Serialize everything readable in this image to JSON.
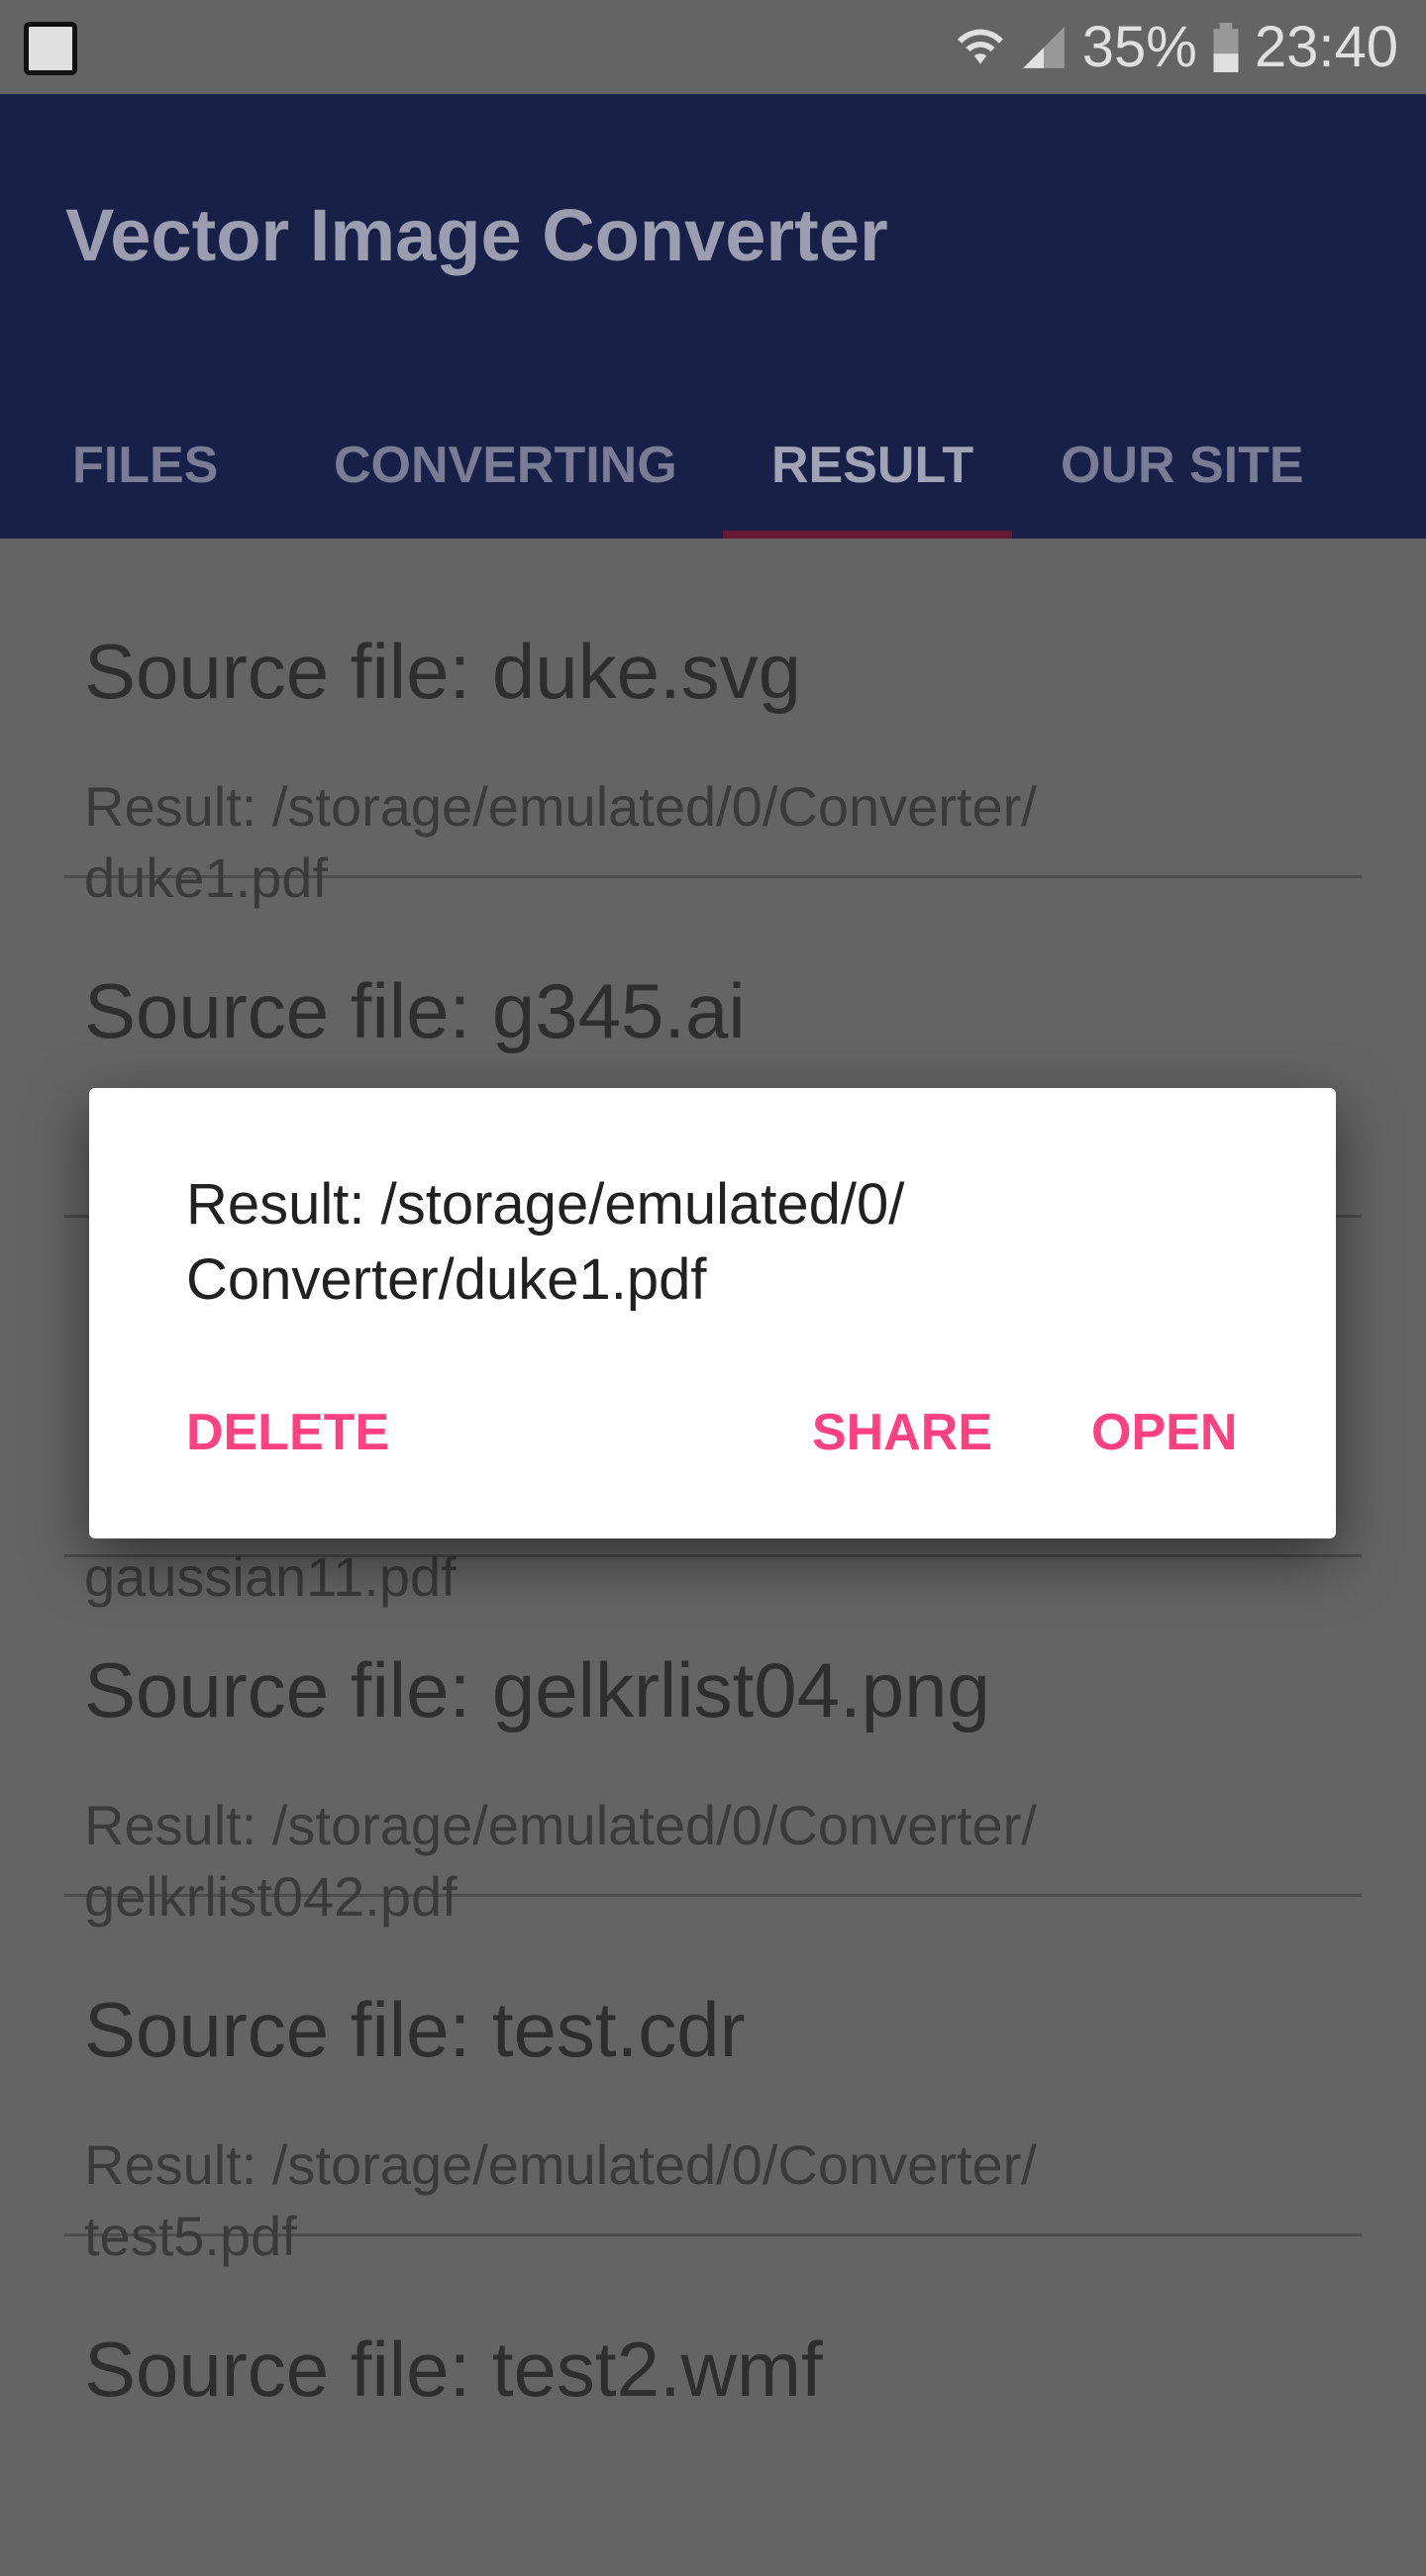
{
  "status_bar": {
    "battery": "35%",
    "time": "23:40",
    "icons": [
      "app-notification-icon",
      "wifi-icon",
      "signal-icon",
      "battery-icon"
    ]
  },
  "app": {
    "title": "Vector Image Converter"
  },
  "tabs": [
    {
      "label": "FILES"
    },
    {
      "label": "CONVERTING"
    },
    {
      "label": "RESULT",
      "active": true
    },
    {
      "label": "OUR SITE"
    }
  ],
  "list": [
    {
      "source": "Source file: duke.svg",
      "result": "Result: /storage/emulated/0/Converter/",
      "result2": "duke1.pdf"
    },
    {
      "source": "Source file: g345.ai",
      "result": "",
      "result2": ""
    },
    {
      "source": "",
      "result": "",
      "result2": "gaussian11.pdf"
    },
    {
      "source": "Source file: gelkrlist04.png",
      "result": "Result: /storage/emulated/0/Converter/",
      "result2": "gelkrlist042.pdf"
    },
    {
      "source": "Source file: test.cdr",
      "result": "Result: /storage/emulated/0/Converter/",
      "result2": "test5.pdf"
    },
    {
      "source": "Source file: test2.wmf",
      "result": "",
      "result2": ""
    }
  ],
  "dialog": {
    "message_line1": "Result: /storage/emulated/0/",
    "message_line2": "Converter/duke1.pdf",
    "delete": "DELETE",
    "share": "SHARE",
    "open": "OPEN"
  },
  "colors": {
    "primary": "#3f51b5",
    "accent": "#ff4081"
  }
}
